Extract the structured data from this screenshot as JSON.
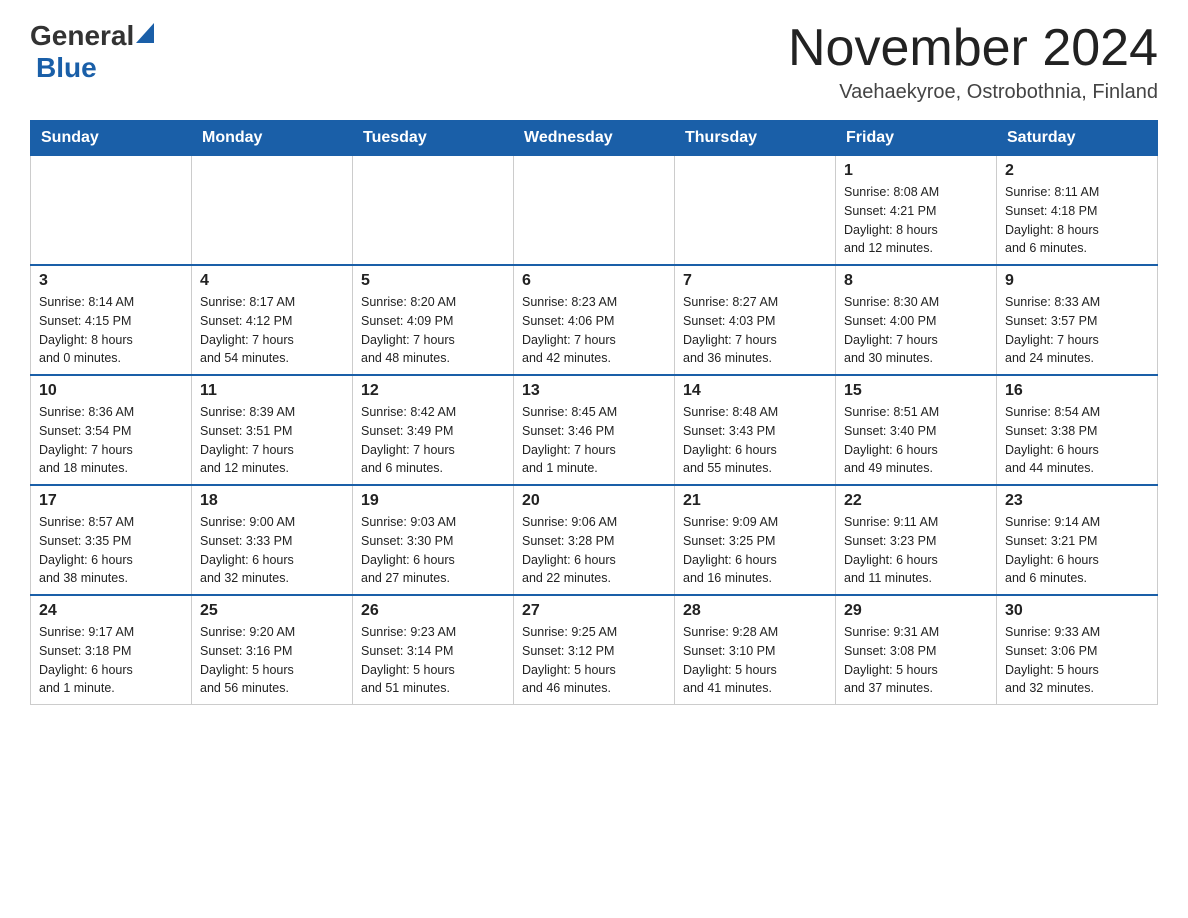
{
  "header": {
    "logo": {
      "text_general": "General",
      "text_blue": "Blue",
      "line2": "Blue"
    },
    "title": "November 2024",
    "location": "Vaehaekyroe, Ostrobothnia, Finland"
  },
  "calendar": {
    "days_of_week": [
      "Sunday",
      "Monday",
      "Tuesday",
      "Wednesday",
      "Thursday",
      "Friday",
      "Saturday"
    ],
    "weeks": [
      [
        {
          "day": "",
          "info": ""
        },
        {
          "day": "",
          "info": ""
        },
        {
          "day": "",
          "info": ""
        },
        {
          "day": "",
          "info": ""
        },
        {
          "day": "",
          "info": ""
        },
        {
          "day": "1",
          "info": "Sunrise: 8:08 AM\nSunset: 4:21 PM\nDaylight: 8 hours\nand 12 minutes."
        },
        {
          "day": "2",
          "info": "Sunrise: 8:11 AM\nSunset: 4:18 PM\nDaylight: 8 hours\nand 6 minutes."
        }
      ],
      [
        {
          "day": "3",
          "info": "Sunrise: 8:14 AM\nSunset: 4:15 PM\nDaylight: 8 hours\nand 0 minutes."
        },
        {
          "day": "4",
          "info": "Sunrise: 8:17 AM\nSunset: 4:12 PM\nDaylight: 7 hours\nand 54 minutes."
        },
        {
          "day": "5",
          "info": "Sunrise: 8:20 AM\nSunset: 4:09 PM\nDaylight: 7 hours\nand 48 minutes."
        },
        {
          "day": "6",
          "info": "Sunrise: 8:23 AM\nSunset: 4:06 PM\nDaylight: 7 hours\nand 42 minutes."
        },
        {
          "day": "7",
          "info": "Sunrise: 8:27 AM\nSunset: 4:03 PM\nDaylight: 7 hours\nand 36 minutes."
        },
        {
          "day": "8",
          "info": "Sunrise: 8:30 AM\nSunset: 4:00 PM\nDaylight: 7 hours\nand 30 minutes."
        },
        {
          "day": "9",
          "info": "Sunrise: 8:33 AM\nSunset: 3:57 PM\nDaylight: 7 hours\nand 24 minutes."
        }
      ],
      [
        {
          "day": "10",
          "info": "Sunrise: 8:36 AM\nSunset: 3:54 PM\nDaylight: 7 hours\nand 18 minutes."
        },
        {
          "day": "11",
          "info": "Sunrise: 8:39 AM\nSunset: 3:51 PM\nDaylight: 7 hours\nand 12 minutes."
        },
        {
          "day": "12",
          "info": "Sunrise: 8:42 AM\nSunset: 3:49 PM\nDaylight: 7 hours\nand 6 minutes."
        },
        {
          "day": "13",
          "info": "Sunrise: 8:45 AM\nSunset: 3:46 PM\nDaylight: 7 hours\nand 1 minute."
        },
        {
          "day": "14",
          "info": "Sunrise: 8:48 AM\nSunset: 3:43 PM\nDaylight: 6 hours\nand 55 minutes."
        },
        {
          "day": "15",
          "info": "Sunrise: 8:51 AM\nSunset: 3:40 PM\nDaylight: 6 hours\nand 49 minutes."
        },
        {
          "day": "16",
          "info": "Sunrise: 8:54 AM\nSunset: 3:38 PM\nDaylight: 6 hours\nand 44 minutes."
        }
      ],
      [
        {
          "day": "17",
          "info": "Sunrise: 8:57 AM\nSunset: 3:35 PM\nDaylight: 6 hours\nand 38 minutes."
        },
        {
          "day": "18",
          "info": "Sunrise: 9:00 AM\nSunset: 3:33 PM\nDaylight: 6 hours\nand 32 minutes."
        },
        {
          "day": "19",
          "info": "Sunrise: 9:03 AM\nSunset: 3:30 PM\nDaylight: 6 hours\nand 27 minutes."
        },
        {
          "day": "20",
          "info": "Sunrise: 9:06 AM\nSunset: 3:28 PM\nDaylight: 6 hours\nand 22 minutes."
        },
        {
          "day": "21",
          "info": "Sunrise: 9:09 AM\nSunset: 3:25 PM\nDaylight: 6 hours\nand 16 minutes."
        },
        {
          "day": "22",
          "info": "Sunrise: 9:11 AM\nSunset: 3:23 PM\nDaylight: 6 hours\nand 11 minutes."
        },
        {
          "day": "23",
          "info": "Sunrise: 9:14 AM\nSunset: 3:21 PM\nDaylight: 6 hours\nand 6 minutes."
        }
      ],
      [
        {
          "day": "24",
          "info": "Sunrise: 9:17 AM\nSunset: 3:18 PM\nDaylight: 6 hours\nand 1 minute."
        },
        {
          "day": "25",
          "info": "Sunrise: 9:20 AM\nSunset: 3:16 PM\nDaylight: 5 hours\nand 56 minutes."
        },
        {
          "day": "26",
          "info": "Sunrise: 9:23 AM\nSunset: 3:14 PM\nDaylight: 5 hours\nand 51 minutes."
        },
        {
          "day": "27",
          "info": "Sunrise: 9:25 AM\nSunset: 3:12 PM\nDaylight: 5 hours\nand 46 minutes."
        },
        {
          "day": "28",
          "info": "Sunrise: 9:28 AM\nSunset: 3:10 PM\nDaylight: 5 hours\nand 41 minutes."
        },
        {
          "day": "29",
          "info": "Sunrise: 9:31 AM\nSunset: 3:08 PM\nDaylight: 5 hours\nand 37 minutes."
        },
        {
          "day": "30",
          "info": "Sunrise: 9:33 AM\nSunset: 3:06 PM\nDaylight: 5 hours\nand 32 minutes."
        }
      ]
    ]
  }
}
